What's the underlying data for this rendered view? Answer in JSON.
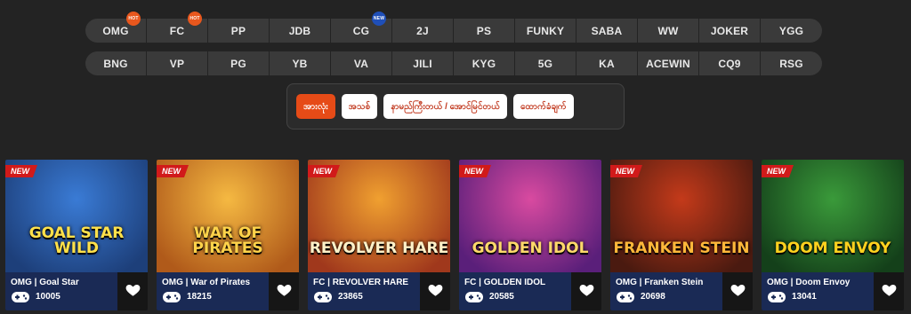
{
  "providers_row1": [
    {
      "label": "OMG",
      "badge": "hot"
    },
    {
      "label": "FC",
      "badge": "hot"
    },
    {
      "label": "PP",
      "badge": ""
    },
    {
      "label": "JDB",
      "badge": ""
    },
    {
      "label": "CG",
      "badge": "new"
    },
    {
      "label": "2J",
      "badge": ""
    },
    {
      "label": "PS",
      "badge": ""
    },
    {
      "label": "FUNKY",
      "badge": ""
    },
    {
      "label": "SABA",
      "badge": ""
    },
    {
      "label": "WW",
      "badge": ""
    },
    {
      "label": "JOKER",
      "badge": ""
    },
    {
      "label": "YGG",
      "badge": ""
    }
  ],
  "providers_row2": [
    {
      "label": "BNG"
    },
    {
      "label": "VP"
    },
    {
      "label": "PG"
    },
    {
      "label": "YB"
    },
    {
      "label": "VA"
    },
    {
      "label": "JILI"
    },
    {
      "label": "KYG"
    },
    {
      "label": "5G"
    },
    {
      "label": "KA"
    },
    {
      "label": "ACEWIN"
    },
    {
      "label": "CQ9"
    },
    {
      "label": "RSG"
    }
  ],
  "badges": {
    "hot": "HOT",
    "new": "NEW"
  },
  "categories": [
    {
      "label": "အားလုံး",
      "active": true
    },
    {
      "label": "အသစ်",
      "active": false
    },
    {
      "label": "နာမည်ကြီးတယ် / အောင်မြင်တယ်",
      "active": false
    },
    {
      "label": "ထောက်ခံချက်",
      "active": false
    }
  ],
  "new_tag": "NEW",
  "games": [
    {
      "provider": "OMG",
      "name": "Goal Star",
      "plays": "10005",
      "art_title": "GOAL STAR WILD",
      "bg1": "#3a7bd5",
      "bg2": "#1d3f7a",
      "title_color": "#ffe14a"
    },
    {
      "provider": "OMG",
      "name": "War of Pirates",
      "plays": "18215",
      "art_title": "WAR OF PIRATES",
      "bg1": "#f5b942",
      "bg2": "#b05a1a",
      "title_color": "#ffd34a"
    },
    {
      "provider": "FC",
      "name": "REVOLVER HARE",
      "plays": "23865",
      "art_title": "REVOLVER HARE",
      "bg1": "#f0a030",
      "bg2": "#a0381c",
      "title_color": "#fff1c8"
    },
    {
      "provider": "FC",
      "name": "GOLDEN IDOL",
      "plays": "20585",
      "art_title": "GOLDEN IDOL",
      "bg1": "#d94aa0",
      "bg2": "#5a1f7a",
      "title_color": "#ffd96a"
    },
    {
      "provider": "OMG",
      "name": "Franken Stein",
      "plays": "20698",
      "art_title": "FRANKEN STEIN",
      "bg1": "#c43a1a",
      "bg2": "#4a1a10",
      "title_color": "#ffb83a"
    },
    {
      "provider": "OMG",
      "name": "Doom Envoy",
      "plays": "13041",
      "art_title": "DOOM ENVOY",
      "bg1": "#3a9a3a",
      "bg2": "#14401a",
      "title_color": "#ffd21e"
    }
  ]
}
